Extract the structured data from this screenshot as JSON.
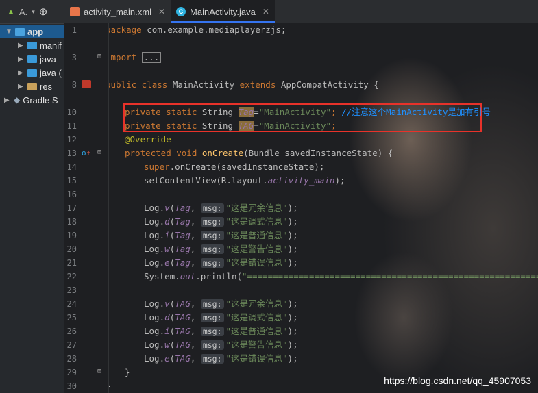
{
  "project_panel": {
    "title": "A.",
    "items": [
      {
        "label": "app",
        "selected": true
      },
      {
        "label": "manif"
      },
      {
        "label": "java"
      },
      {
        "label": "java ("
      },
      {
        "label": "res"
      },
      {
        "label": "Gradle S"
      }
    ]
  },
  "tabs": [
    {
      "label": "activity_main.xml",
      "active": false
    },
    {
      "label": "MainActivity.java",
      "active": true
    }
  ],
  "line_numbers": [
    "1",
    "3",
    "8",
    "10",
    "11",
    "12",
    "13",
    "14",
    "15",
    "16",
    "17",
    "18",
    "19",
    "20",
    "21",
    "22",
    "23",
    "24",
    "25",
    "26",
    "27",
    "28",
    "29",
    "30"
  ],
  "code": {
    "l1_package": "package",
    "l1_name": " com.example.mediaplayerzjs;",
    "l3_import": "import",
    "l3_fold": "...",
    "l8_public": "public class",
    "l8_name": " MainActivity ",
    "l8_extends": "extends",
    "l8_super": " AppCompatActivity {",
    "l10_mod": "private static",
    "l10_type": " String ",
    "l10_var": "Tag",
    "l10_eq": "=",
    "l10_str": "\"MainActivity\"",
    "l10_semi": "; ",
    "l10_cmt": "//注意这个MainActivity是加有引号",
    "l11_mod": "private static",
    "l11_type": " String ",
    "l11_var": "TAG",
    "l11_eq": "=",
    "l11_str": "\"MainActivity\"",
    "l11_semi": ";",
    "l12_ann": "@Override",
    "l13_mod": "protected void",
    "l13_fn": " onCreate",
    "l13_args": "(Bundle savedInstanceState) {",
    "l14_super": "super",
    "l14_rest": ".onCreate(savedInstanceState);",
    "l15_call": "setContentView(R.layout.",
    "l15_field": "activity_main",
    "l15_end": ");",
    "hint": "msg:",
    "log_lines": [
      {
        "m": "v",
        "tag": "Tag",
        "text": "\"这是冗余信息\""
      },
      {
        "m": "d",
        "tag": "Tag",
        "text": "\"这是调式信息\""
      },
      {
        "m": "i",
        "tag": "Tag",
        "text": "\"这是普通信息\""
      },
      {
        "m": "w",
        "tag": "Tag",
        "text": "\"这是警告信息\""
      },
      {
        "m": "e",
        "tag": "Tag",
        "text": "\"这是错误信息\""
      },
      {
        "m": "v",
        "tag": "TAG",
        "text": "\"这是冗余信息\""
      },
      {
        "m": "d",
        "tag": "TAG",
        "text": "\"这是调式信息\""
      },
      {
        "m": "i",
        "tag": "TAG",
        "text": "\"这是普通信息\""
      },
      {
        "m": "w",
        "tag": "TAG",
        "text": "\"这是警告信息\""
      },
      {
        "m": "e",
        "tag": "TAG",
        "text": "\"这是错误信息\""
      }
    ],
    "log_prefix": "Log.",
    "log_open": "(",
    "log_comma": ", ",
    "log_close": ");",
    "l22_sys": "System.",
    "l22_out": "out",
    "l22_print": ".println(",
    "l22_str": "\"=============================================================\"",
    "l22_end": ");",
    "brace_close": "}"
  },
  "watermark": "https://blog.csdn.net/qq_45907053",
  "colors": {
    "accent": "#3574f0",
    "highlight_box": "#e8322a"
  }
}
